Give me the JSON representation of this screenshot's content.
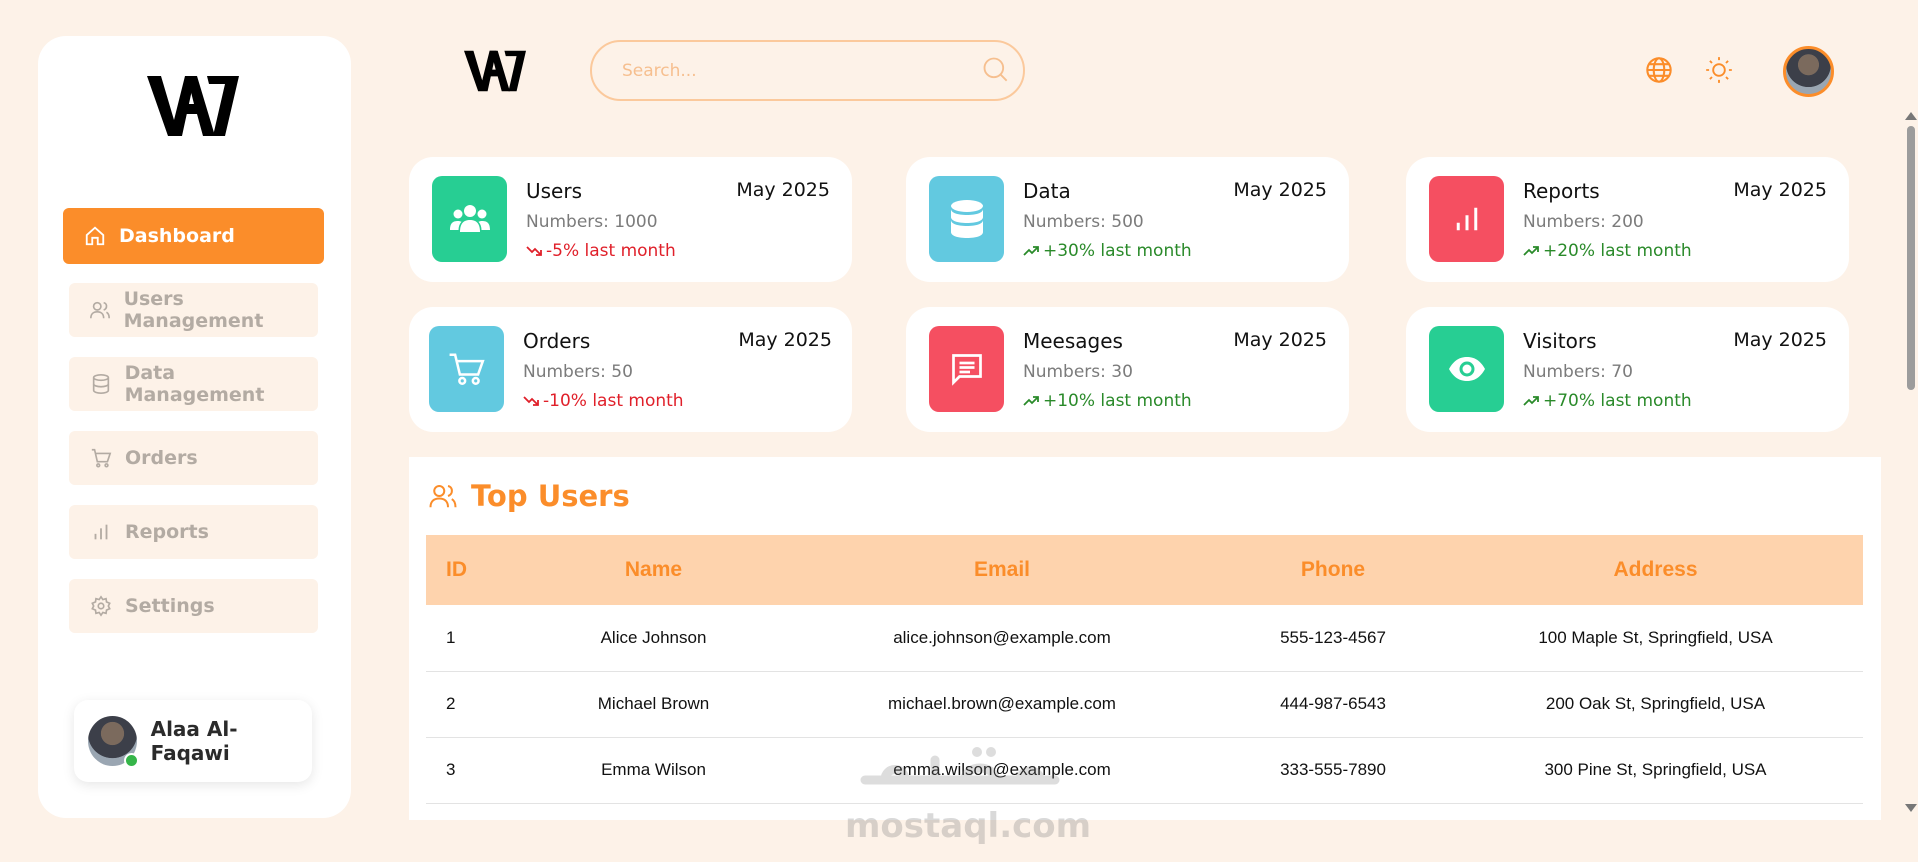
{
  "sidebar": {
    "items": [
      {
        "label": "Dashboard",
        "icon": "home-icon",
        "active": true
      },
      {
        "label": "Users Management",
        "icon": "users-icon"
      },
      {
        "label": "Data Management",
        "icon": "database-icon"
      },
      {
        "label": "Orders",
        "icon": "cart-icon"
      },
      {
        "label": "Reports",
        "icon": "bar-chart-icon"
      },
      {
        "label": "Settings",
        "icon": "gear-icon"
      }
    ],
    "profile": {
      "name": "Alaa Al-Faqawi",
      "status": "online"
    }
  },
  "header": {
    "search_placeholder": "Search...",
    "icons": [
      "globe-icon",
      "sun-icon"
    ]
  },
  "stats": [
    {
      "title": "Users",
      "date": "May 2025",
      "numbers": "Numbers: 1000",
      "trend": "-5% last month",
      "direction": "down",
      "color": "#27ce93",
      "icon": "users-icon"
    },
    {
      "title": "Data",
      "date": "May 2025",
      "numbers": "Numbers: 500",
      "trend": "+30% last month",
      "direction": "up",
      "color": "#62c9e0",
      "icon": "database-icon"
    },
    {
      "title": "Reports",
      "date": "May 2025",
      "numbers": "Numbers: 200",
      "trend": "+20% last month",
      "direction": "up",
      "color": "#f54f61",
      "icon": "bar-chart-icon"
    },
    {
      "title": "Orders",
      "date": "May 2025",
      "numbers": "Numbers: 50",
      "trend": "-10% last month",
      "direction": "down",
      "color": "#62c9e0",
      "icon": "cart-icon"
    },
    {
      "title": "Meesages",
      "date": "May 2025",
      "numbers": "Numbers: 30",
      "trend": "+10% last month",
      "direction": "up",
      "color": "#f54f61",
      "icon": "message-icon"
    },
    {
      "title": "Visitors",
      "date": "May 2025",
      "numbers": "Numbers: 70",
      "trend": "+70% last month",
      "direction": "up",
      "color": "#27ce93",
      "icon": "eye-icon"
    }
  ],
  "top_users": {
    "title": "Top Users",
    "columns": [
      "ID",
      "Name",
      "Email",
      "Phone",
      "Address"
    ],
    "rows": [
      [
        "1",
        "Alice Johnson",
        "alice.johnson@example.com",
        "555-123-4567",
        "100 Maple St, Springfield, USA"
      ],
      [
        "2",
        "Michael Brown",
        "michael.brown@example.com",
        "444-987-6543",
        "200 Oak St, Springfield, USA"
      ],
      [
        "3",
        "Emma Wilson",
        "emma.wilson@example.com",
        "333-555-7890",
        "300 Pine St, Springfield, USA"
      ]
    ]
  },
  "watermark": "mostaql.com",
  "colors": {
    "accent": "#fb8d2a",
    "background": "#fdf2e8",
    "table_header": "#fed3ad",
    "down": "#e0202a",
    "up": "#2a8a2a"
  }
}
